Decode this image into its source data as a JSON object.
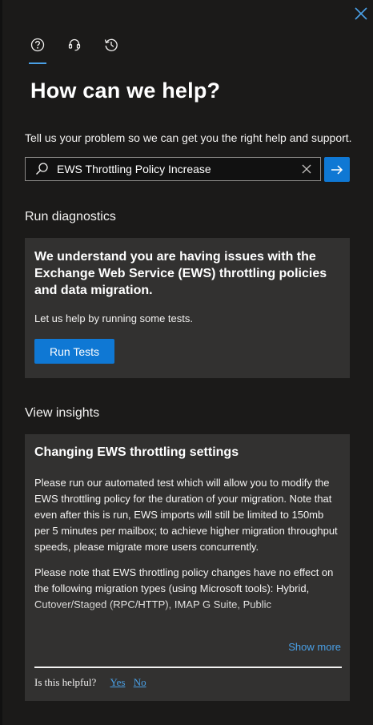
{
  "tabs": [
    {
      "icon": "help-circle-icon",
      "active": true
    },
    {
      "icon": "headset-icon",
      "active": false
    },
    {
      "icon": "history-icon",
      "active": false
    }
  ],
  "heading": "How can we help?",
  "intro": "Tell us your problem so we can get you the right help and support.",
  "search": {
    "value": "EWS Throttling Policy Increase"
  },
  "diagnostics": {
    "section_title": "Run diagnostics",
    "message": "We understand you are having issues with the Exchange Web Service (EWS) throttling policies and data migration.",
    "sub": "Let us help by running some tests.",
    "button_label": "Run Tests"
  },
  "insights": {
    "section_title": "View insights",
    "card_title": "Changing EWS throttling settings",
    "paragraphs": [
      "Please run our automated test which will allow you to modify the EWS throttling policy for the duration of your migration. Note that even after this is run, EWS imports will still be limited to 150mb per 5 minutes per mailbox; to achieve higher migration throughput speeds, please migrate more users concurrently.",
      "Please note that EWS throttling policy changes have no effect on the following migration types (using Microsoft tools): Hybrid, Cutover/Staged (RPC/HTTP), IMAP G Suite, Public"
    ],
    "show_more": "Show more",
    "helpful_label": "Is this helpful?",
    "yes": "Yes",
    "no": "No"
  },
  "colors": {
    "accent": "#0f78d4",
    "link": "#4aa0e6",
    "background": "#1b1a19",
    "card": "#323130"
  }
}
